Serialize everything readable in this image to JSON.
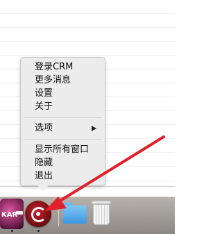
{
  "context_menu": {
    "items": [
      {
        "label": "登录CRM"
      },
      {
        "label": "更多消息"
      },
      {
        "label": "设置"
      },
      {
        "label": "关于"
      },
      {
        "label": "选项",
        "has_submenu": true
      },
      {
        "label": "显示所有窗口"
      },
      {
        "label": "隐藏"
      },
      {
        "label": "退出"
      }
    ]
  },
  "dock": {
    "apps": [
      {
        "name": "kar-app",
        "label": "KAR"
      },
      {
        "name": "crm-app",
        "running": true
      },
      {
        "name": "folder"
      },
      {
        "name": "trash"
      }
    ]
  },
  "colors": {
    "arrow": "#e0202a",
    "menu_bg": "#ececec"
  }
}
